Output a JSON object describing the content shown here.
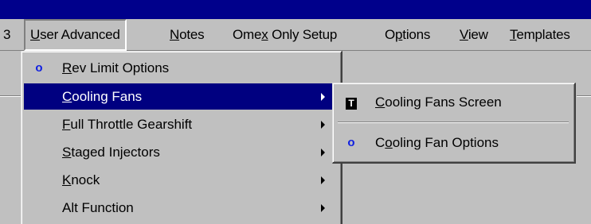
{
  "menubar": {
    "partial_left": "3",
    "items": [
      {
        "pre": "",
        "u": "U",
        "post": "ser Advanced"
      },
      {
        "pre": "",
        "u": "N",
        "post": "otes"
      },
      {
        "pre": "Ome",
        "u": "x",
        "post": " Only Setup"
      },
      {
        "pre": "O",
        "u": "p",
        "post": "tions"
      },
      {
        "pre": "",
        "u": "V",
        "post": "iew"
      },
      {
        "pre": "",
        "u": "T",
        "post": "emplates"
      }
    ]
  },
  "menu": {
    "items": [
      {
        "icon": "o",
        "pre": "",
        "u": "R",
        "post": "ev Limit Options"
      },
      {
        "pre": "",
        "u": "C",
        "post": "ooling Fans"
      },
      {
        "pre": "",
        "u": "F",
        "post": "ull Throttle Gearshift"
      },
      {
        "pre": "",
        "u": "S",
        "post": "taged Injectors"
      },
      {
        "pre": "",
        "u": "K",
        "post": "nock"
      },
      {
        "pre": "Alt Function",
        "u": "",
        "post": ""
      }
    ]
  },
  "submenu": {
    "items": [
      {
        "icon": "T",
        "pre": "",
        "u": "C",
        "post": "ooling Fans Screen"
      },
      {
        "icon": "o",
        "pre": "C",
        "u": "o",
        "post": "oling Fan Options"
      }
    ]
  },
  "colors": {
    "titlebar": "#00008b",
    "highlight": "#000080",
    "face": "#c0c0c0",
    "icon_blue": "#1020e0"
  }
}
